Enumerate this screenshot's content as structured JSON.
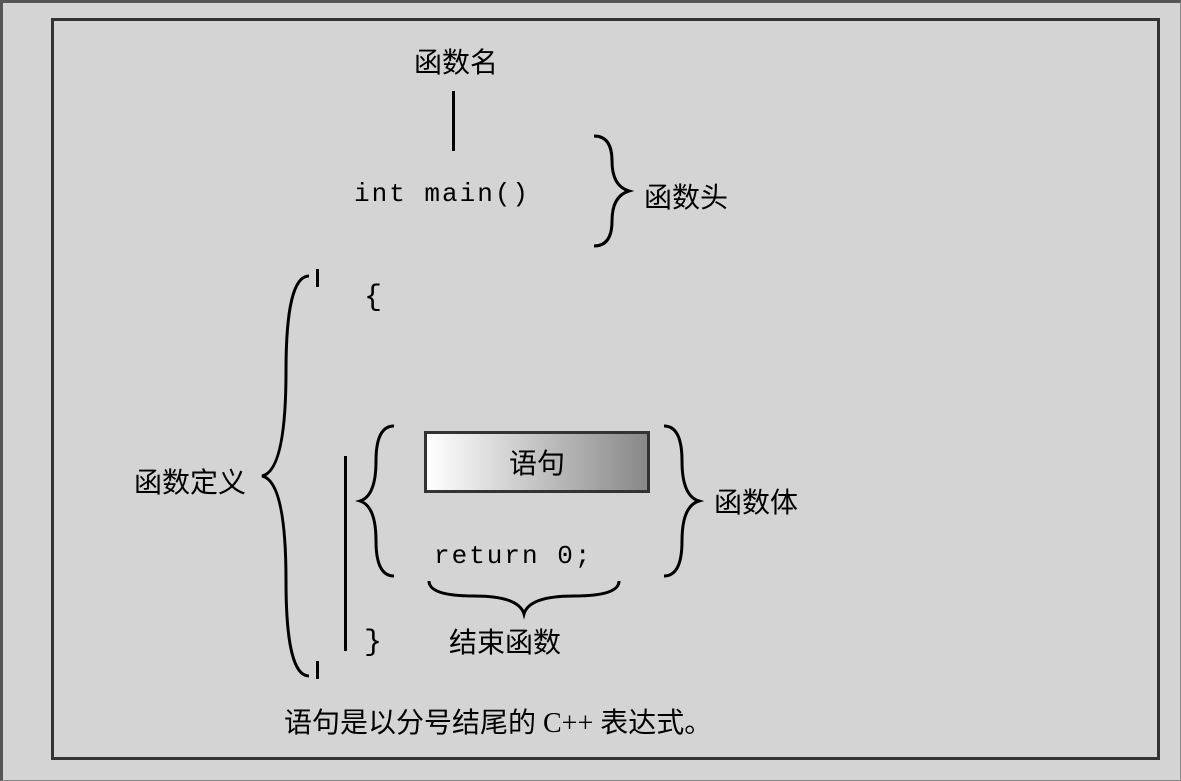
{
  "labels": {
    "function_name": "函数名",
    "function_head": "函数头",
    "function_definition": "函数定义",
    "function_body": "函数体",
    "statement": "语句",
    "end_function": "结束函数"
  },
  "code": {
    "signature": "int main()",
    "open_brace": "{",
    "return_stmt": "return 0;",
    "close_brace": "}"
  },
  "caption": "语句是以分号结尾的 C++ 表达式。"
}
